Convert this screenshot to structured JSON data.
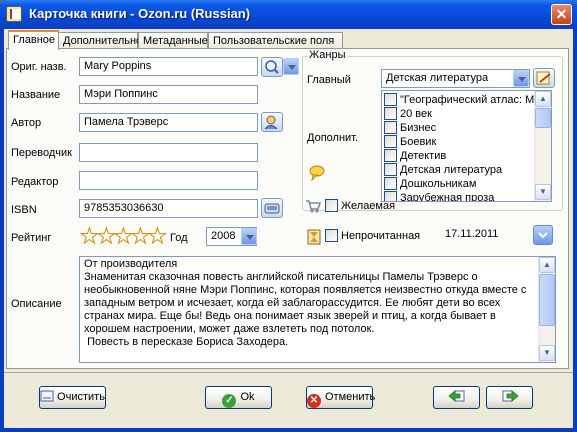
{
  "window": {
    "title": "Карточка книги - Ozon.ru (Russian)"
  },
  "tabs": [
    "Главное",
    "Дополнительно",
    "Метаданные",
    "Пользовательские поля"
  ],
  "fields": {
    "orig_title": {
      "label": "Ориг. назв.",
      "value": "Mary Poppins"
    },
    "title": {
      "label": "Название",
      "value": "Мэри Поппинс"
    },
    "author": {
      "label": "Автор",
      "value": "Памела Трэверс"
    },
    "translator": {
      "label": "Переводчик",
      "value": ""
    },
    "editor": {
      "label": "Редактор",
      "value": ""
    },
    "isbn": {
      "label": "ISBN",
      "value": "9785353036630"
    },
    "rating": {
      "label": "Рейтинг",
      "stars_filled": 0,
      "stars_total": 5
    },
    "year": {
      "label": "Год",
      "value": "2008"
    },
    "description": {
      "label": "Описание",
      "text": "От производителя\nЗнаменитая сказочная повесть английской писательницы Памелы Трэверс о необыкновенной няне Мэри Поппинс, которая появляется неизвестно откуда вместе с западным ветром и исчезает, когда ей заблагорассудится. Ее любят дети во всех странах мира. Еще бы! Ведь она понимает язык зверей и птиц, а когда бывает в хорошем настроении, может даже взлететь под потолок.\n Повесть в пересказе Бориса Заходера."
    }
  },
  "genres": {
    "group_title": "Жанры",
    "main_label": "Главный",
    "main_value": "Детская литература",
    "extra_label": "Дополнит.",
    "items": [
      "\"Географический атлас: Мир и",
      "20 век",
      "Бизнес",
      "Боевик",
      "Детектив",
      "Детская литература",
      "Дошкольникам",
      "Зарубежная проза"
    ]
  },
  "flags": {
    "wanted_label": "Желаемая",
    "unread_label": "Непрочитанная",
    "date_value": "17.11.2011"
  },
  "buttons": {
    "clear": "Очистить",
    "ok": "Ok",
    "cancel": "Отменить"
  },
  "colors": {
    "tab_accent": "#e68b2c",
    "titlebar": "#0a58e8"
  }
}
